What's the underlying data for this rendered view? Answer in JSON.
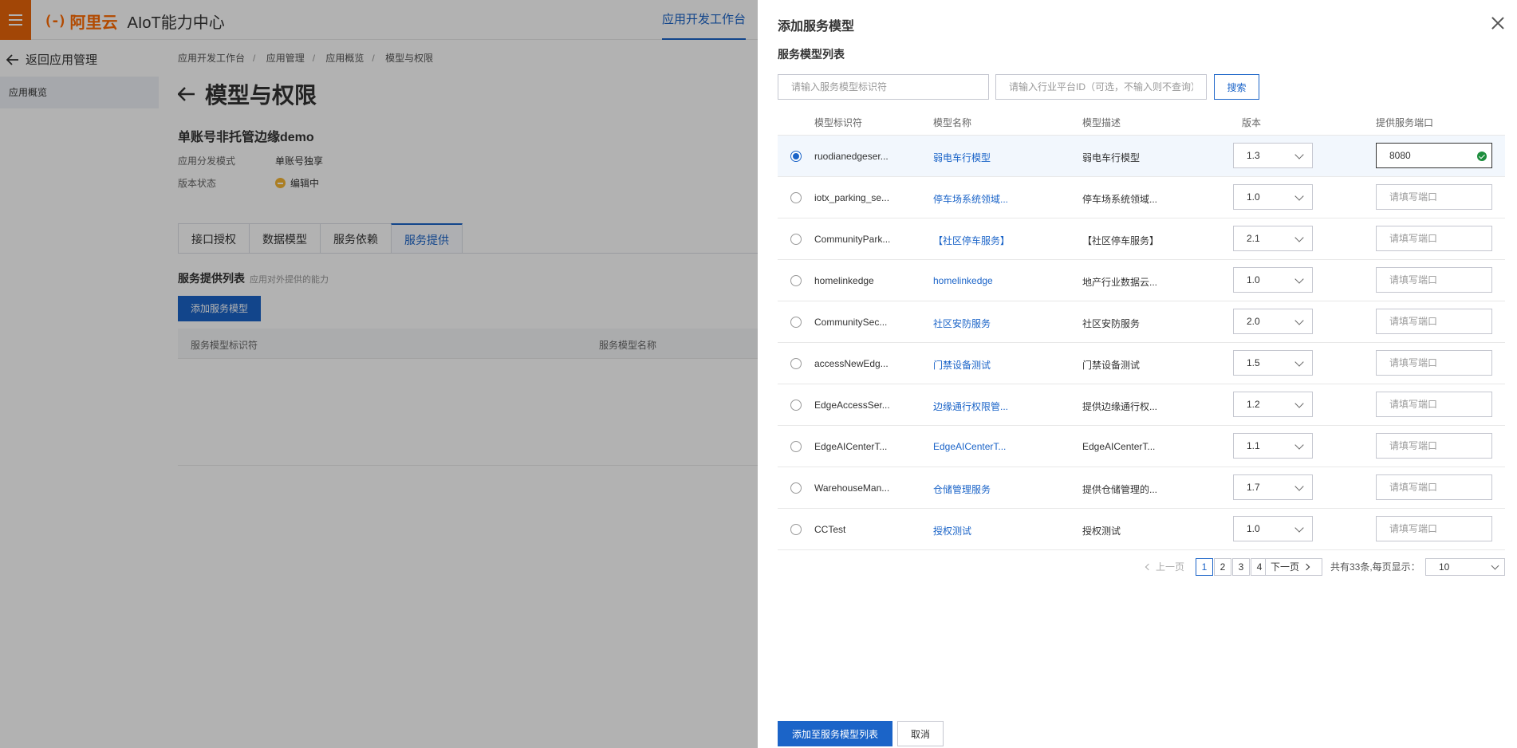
{
  "topbar": {
    "logo_mark": "(-)",
    "logo_cn": "阿里云",
    "app_title": "AIoT能力中心",
    "active_tab": "应用开发工作台"
  },
  "sidebar": {
    "back_label": "返回应用管理",
    "items": [
      {
        "label": "应用概览"
      }
    ]
  },
  "main": {
    "breadcrumb": [
      "应用开发工作台",
      "应用管理",
      "应用概览",
      "模型与权限"
    ],
    "page_title": "模型与权限",
    "app_name": "单账号非托管边缘demo",
    "info": [
      {
        "key": "应用分发模式",
        "value": "单账号独享"
      },
      {
        "key": "版本状态",
        "value": "编辑中"
      }
    ],
    "tabs": [
      "接口授权",
      "数据模型",
      "服务依赖",
      "服务提供"
    ],
    "section_title": "服务提供列表",
    "section_sub": "应用对外提供的能力",
    "add_button": "添加服务模型",
    "table_headers": [
      "服务模型标识符",
      "服务模型名称"
    ]
  },
  "drawer": {
    "title": "添加服务模型",
    "list_title": "服务模型列表",
    "search": {
      "id_placeholder": "请输入服务模型标识符",
      "industry_placeholder": "请输入行业平台ID（可选，不输入则不查询）",
      "button": "搜索"
    },
    "table_headers": [
      "模型标识符",
      "模型名称",
      "模型描述",
      "版本",
      "提供服务端口"
    ],
    "port_placeholder": "请填写端口",
    "rows": [
      {
        "id": "ruodianedgeser...",
        "name": "弱电车行模型",
        "desc": "弱电车行模型",
        "version": "1.3",
        "port": "8080",
        "selected": true
      },
      {
        "id": "iotx_parking_se...",
        "name": "停车场系统领域...",
        "desc": "停车场系统领域...",
        "version": "1.0",
        "port": "",
        "selected": false
      },
      {
        "id": "CommunityPark...",
        "name": "【社区停车服务】",
        "desc": "【社区停车服务】",
        "version": "2.1",
        "port": "",
        "selected": false
      },
      {
        "id": "homelinkedge",
        "name": "homelinkedge",
        "desc": "地产行业数据云...",
        "version": "1.0",
        "port": "",
        "selected": false
      },
      {
        "id": "CommunitySec...",
        "name": "社区安防服务",
        "desc": "社区安防服务",
        "version": "2.0",
        "port": "",
        "selected": false
      },
      {
        "id": "accessNewEdg...",
        "name": "门禁设备测试",
        "desc": "门禁设备测试",
        "version": "1.5",
        "port": "",
        "selected": false
      },
      {
        "id": "EdgeAccessSer...",
        "name": "边缘通行权限管...",
        "desc": "提供边缘通行权...",
        "version": "1.2",
        "port": "",
        "selected": false
      },
      {
        "id": "EdgeAICenterT...",
        "name": "EdgeAICenterT...",
        "desc": "EdgeAICenterT...",
        "version": "1.1",
        "port": "",
        "selected": false
      },
      {
        "id": "WarehouseMan...",
        "name": "仓储管理服务",
        "desc": "提供仓储管理的...",
        "version": "1.7",
        "port": "",
        "selected": false
      },
      {
        "id": "CCTest",
        "name": "授权测试",
        "desc": "授权测试",
        "version": "1.0",
        "port": "",
        "selected": false
      }
    ],
    "pagination": {
      "prev": "上一页",
      "pages": [
        "1",
        "2",
        "3",
        "4"
      ],
      "current": "1",
      "next": "下一页",
      "total_text": "共有33条,每页显示：",
      "page_size": "10"
    },
    "footer": {
      "ok": "添加至服务模型列表",
      "cancel": "取消"
    },
    "colors": {
      "primary": "#1b64c8",
      "brand": "#ff6a00",
      "success": "#1e8e3e"
    }
  }
}
